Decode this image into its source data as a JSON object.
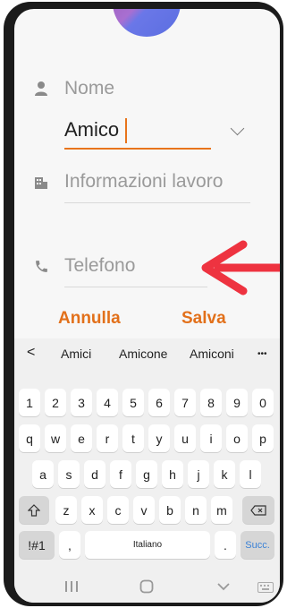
{
  "form": {
    "name_label": "Nome",
    "name_value": "Amico",
    "work_label": "Informazioni lavoro",
    "phone_label": "Telefono",
    "cancel_label": "Annulla",
    "save_label": "Salva"
  },
  "keyboard": {
    "suggestions": [
      "Amici",
      "Amicone",
      "Amiconi"
    ],
    "back_symbol": "<",
    "more_symbol": "•••",
    "row_numbers": [
      "1",
      "2",
      "3",
      "4",
      "5",
      "6",
      "7",
      "8",
      "9",
      "0"
    ],
    "row1": [
      "q",
      "w",
      "e",
      "r",
      "t",
      "y",
      "u",
      "i",
      "o",
      "p"
    ],
    "row2": [
      "a",
      "s",
      "d",
      "f",
      "g",
      "h",
      "j",
      "k",
      "l"
    ],
    "row3": [
      "z",
      "x",
      "c",
      "v",
      "b",
      "n",
      "m"
    ],
    "symbols_key": "!#1",
    "comma_key": ",",
    "space_label": "Italiano",
    "period_key": ".",
    "next_key": "Succ.",
    "accent_color": "#e2701a",
    "next_color": "#3b82d6"
  },
  "navigation": {
    "recent_icon": "recent-apps-icon",
    "home_icon": "home-icon",
    "back_icon": "back-icon",
    "keyboard_icon": "keyboard-hide-icon"
  }
}
